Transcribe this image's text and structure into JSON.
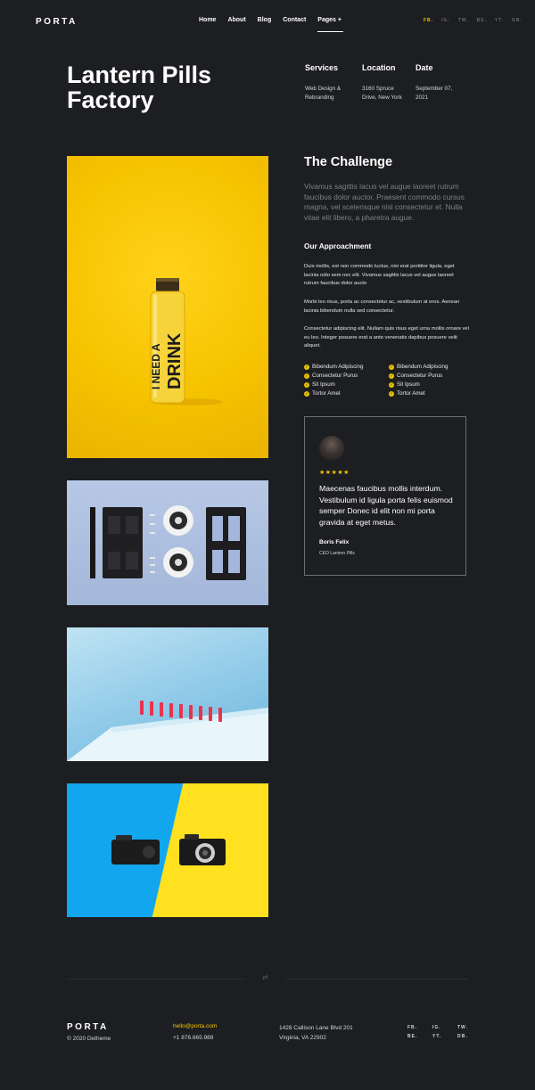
{
  "header": {
    "logo": "PORTA",
    "nav": [
      "Home",
      "About",
      "Blog",
      "Contact",
      "Pages +"
    ],
    "social": [
      "FB.",
      "IG.",
      "TW.",
      "BE.",
      "YT.",
      "DB."
    ]
  },
  "project": {
    "title": "Lantern Pills Factory",
    "meta": [
      {
        "label": "Services",
        "value": "Web Design & Rebranding"
      },
      {
        "label": "Location",
        "value": "3160 Spruce Drive, New York"
      },
      {
        "label": "Date",
        "value": "September 07, 2021"
      }
    ]
  },
  "images": {
    "bottle_text_1": "I NEED A",
    "bottle_text_2": "DRINK"
  },
  "challenge": {
    "heading": "The Challenge",
    "lead": "Vivamus sagittis lacus vel augue laoreet rutrum faucibus dolor auctor. Praesent commodo cursus magna, vel scelerisque nisl consectetur et. Nulla vitae elit libero, a pharetra augue.",
    "approach_heading": "Our Approachment",
    "paragraphs": [
      "Duis mollis, est non commodo luctus, nisi erat porttitor ligula, eget lacinia odio sem nec elit. Vivamus sagittis lacus vel augue laoreet rutrum faucibus dolor aucto",
      "Morbi leo risus, porta ac consectetur ac, vestibulum at eros. Aenean lacinia bibendum nulla sed consectetur.",
      "Consectetur adipiscing elit. Nullam quis risus eget urna mollis ornare vel eu leo. Integer posuere erat a ante venenatis dapibus posuere velit aliquet."
    ],
    "list_left": [
      "Bibendum Adipiscing",
      "Consectetur Purus",
      "Sit Ipsum",
      "Tortor Amet"
    ],
    "list_right": [
      "Bibendum Adipiscing",
      "Consectetur Purus",
      "Sit Ipsum",
      "Tortor Amet"
    ]
  },
  "testimonial": {
    "stars": "★★★★★",
    "quote": "Maecenas faucibus mollis interdum. Vestibulum id ligula porta felis euismod semper Donec id elit non mi porta gravida at eget metus.",
    "author": "Boris Felix",
    "role": "CEO Lantern Pills"
  },
  "footer": {
    "logo": "PORTA",
    "copyright": "© 2020 Detheme",
    "email": "hello@porta.com",
    "phone": "+1 876.665.989",
    "address_line1": "1428 Callison Lane Blvd 201",
    "address_line2": "Virginia, VA 22902",
    "social": [
      "FB.",
      "IG.",
      "TW.",
      "BE.",
      "YT.",
      "DB."
    ]
  },
  "colors": {
    "background": "#1d1e21",
    "accent": "#f5c800"
  }
}
